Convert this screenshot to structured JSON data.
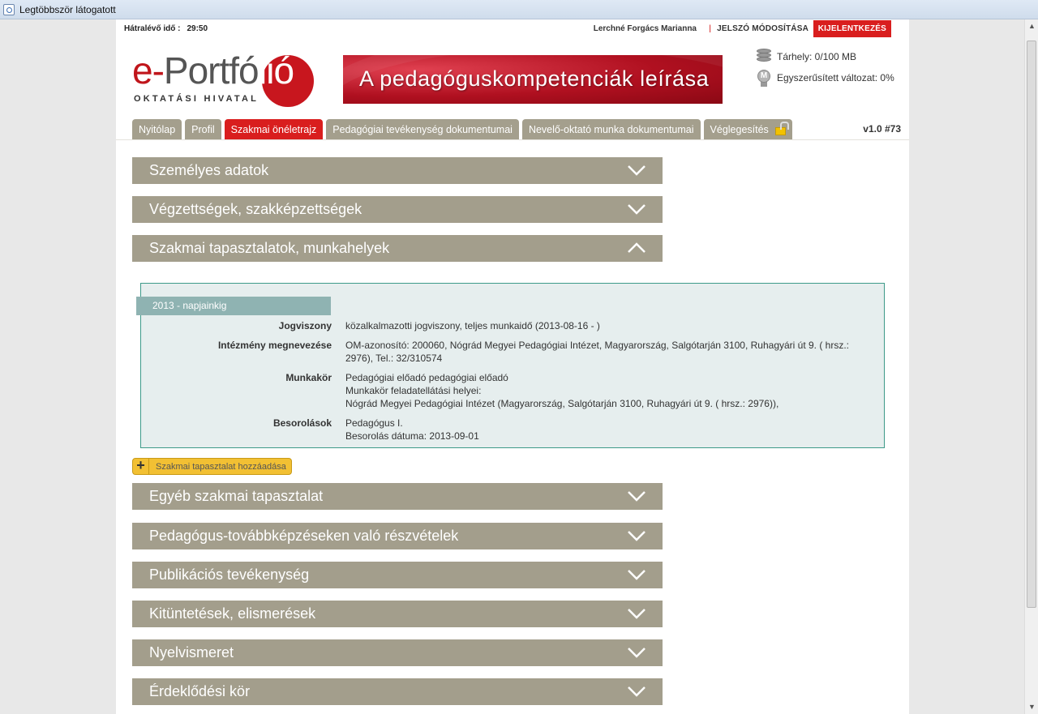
{
  "browser": {
    "title": "Legtöbbször látogatott"
  },
  "header": {
    "timer_label": "Hátralévő idő :",
    "timer_value": "29:50",
    "user_name": "Lerchné Forgács Marianna",
    "separator": "|",
    "password_link": "JELSZÓ MÓDOSÍTÁSA",
    "logout_button": "KIJELENTKEZÉS"
  },
  "logo": {
    "prefix": "e-",
    "main": "Portfó",
    "suffix": "lió",
    "subtitle": "OKTATÁSI HIVATAL"
  },
  "banner": {
    "text": "A pedagóguskompetenciák leírása"
  },
  "stats": {
    "storage": "Tárhely: 0/100 MB",
    "simplified": "Egyszerűsített változat: 0%",
    "storage_icon": "database-icon",
    "medal_icon": "medal-icon"
  },
  "tabs": [
    {
      "label": "Nyitólap",
      "active": false
    },
    {
      "label": "Profil",
      "active": false
    },
    {
      "label": "Szakmai önéletrajz",
      "active": true
    },
    {
      "label": "Pedagógiai tevékenység dokumentumai",
      "active": false
    },
    {
      "label": "Nevelő-oktató munka dokumentumai",
      "active": false
    },
    {
      "label": "Véglegesítés",
      "active": false
    }
  ],
  "version": "v1.0 #73",
  "sections": [
    {
      "title": "Személyes adatok",
      "expanded": false
    },
    {
      "title": "Végzettségek, szakképzettségek",
      "expanded": false
    },
    {
      "title": "Szakmai tapasztalatok, munkahelyek",
      "expanded": true
    },
    {
      "title": "Egyéb szakmai tapasztalat",
      "expanded": false
    },
    {
      "title": "Pedagógus-továbbképzéseken való részvételek",
      "expanded": false
    },
    {
      "title": "Publikációs tevékenység",
      "expanded": false
    },
    {
      "title": "Kitüntetések, elismerések",
      "expanded": false
    },
    {
      "title": "Nyelvismeret",
      "expanded": false
    },
    {
      "title": "Érdeklődési kör",
      "expanded": false
    }
  ],
  "experience": {
    "period": "2013 - napjainkig",
    "rows": [
      {
        "label": "Jogviszony",
        "value": "közalkalmazotti jogviszony, teljes munkaidő (2013-08-16 - )"
      },
      {
        "label": "Intézmény megnevezése",
        "value": "OM-azonosító: 200060, Nógrád Megyei Pedagógiai Intézet, Magyarország, Salgótarján 3100, Ruhagyári út 9. ( hrsz.: 2976), Tel.: 32/310574"
      },
      {
        "label": "Munkakör",
        "value": "Pedagógiai előadó pedagógiai előadó\nMunkakör feladatellátási helyei:\nNógrád Megyei Pedagógiai Intézet (Magyarország, Salgótarján 3100, Ruhagyári út 9. ( hrsz.: 2976)),"
      },
      {
        "label": "Besorolások",
        "value": "Pedagógus I.\nBesorolás dátuma: 2013-09-01"
      }
    ]
  },
  "add_button": {
    "label": "Szakmai tapasztalat hozzáadása"
  }
}
